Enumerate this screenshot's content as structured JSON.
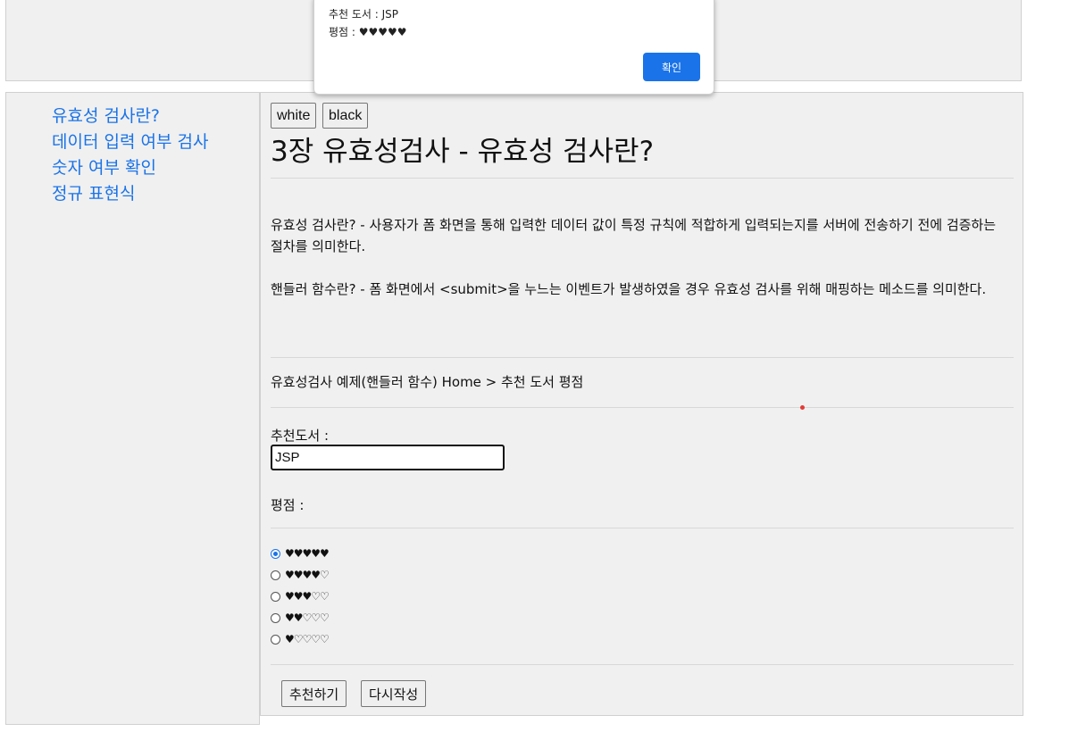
{
  "dialog": {
    "line1": "추천 도서 : JSP",
    "line2": "평점 : ♥♥♥♥♥",
    "ok_label": "확인"
  },
  "sidebar": {
    "links": [
      "유효성 검사란?",
      "데이터 입력 여부 검사",
      "숫자 여부 확인",
      "정규 표현식"
    ]
  },
  "theme": {
    "white_label": "white",
    "black_label": "black"
  },
  "main": {
    "title": "3장 유효성검사 - 유효성 검사란?",
    "para1": "유효성 검사란? - 사용자가 폼 화면을 통해 입력한 데이터 값이 특정 규칙에 적합하게 입력되는지를 서버에 전송하기 전에 검증하는 절차를 의미한다.",
    "para2": "핸들러 함수란? - 폼 화면에서 <submit>을 누느는 이벤트가 발생하였을 경우 유효성 검사를 위해 매핑하는 메소드를 의미한다.",
    "breadcrumb": "유효성검사 예제(핸들러 함수) Home > 추천 도서 평점"
  },
  "form": {
    "book_label": "추천도서 :",
    "book_value": "JSP",
    "rating_label": "평점 :",
    "rating_options": [
      "♥♥♥♥♥",
      "♥♥♥♥♡",
      "♥♥♥♡♡",
      "♥♥♡♡♡",
      "♥♡♡♡♡"
    ],
    "selected_rating": "♥♥♥♥♥",
    "submit_label": "추천하기",
    "reset_label": "다시작성"
  },
  "colors": {
    "link": "#1a73e8",
    "panel_bg": "#f0f0f0",
    "dialog_button": "#1a73e8"
  }
}
